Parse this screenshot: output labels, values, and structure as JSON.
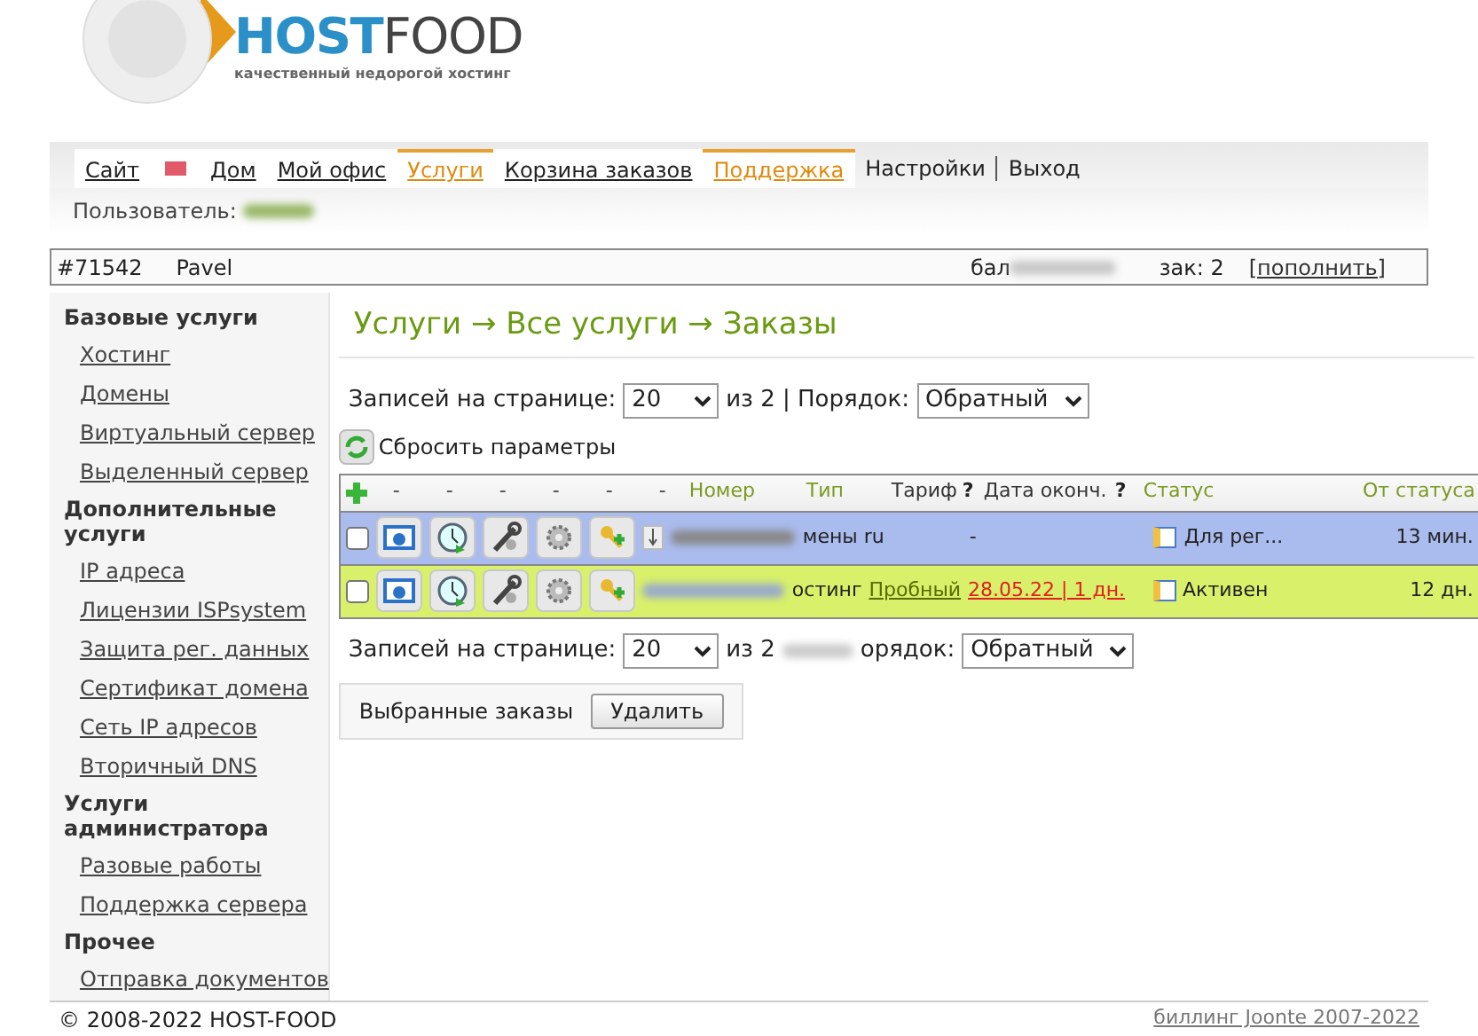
{
  "logo": {
    "brand_part_1": "HOST",
    "brand_part_2": "FOOD",
    "tagline": "качественный недорогой хостинг"
  },
  "nav": [
    {
      "label": "Сайт",
      "kind": "link",
      "selected": false
    },
    {
      "kind": "mail",
      "selected": false
    },
    {
      "label": "Дом",
      "kind": "link",
      "selected": false
    },
    {
      "label": "Мой офис",
      "kind": "link",
      "selected": false
    },
    {
      "label": "Услуги",
      "kind": "link",
      "selected": true
    },
    {
      "label": "Корзина заказов",
      "kind": "link",
      "selected": false
    },
    {
      "label": "Поддержка",
      "kind": "link",
      "selected": true
    },
    {
      "label": "Настройки",
      "kind": "plain",
      "selected": false
    },
    {
      "label": "Выход",
      "kind": "plain",
      "selected": false
    }
  ],
  "user_label": "Пользователь:",
  "account": {
    "id": "#71542",
    "name": "Pavel",
    "balance_label": "бал",
    "orders": "зак: 2",
    "topup": "[пополнить]"
  },
  "sidebar": [
    {
      "title": "Базовые услуги",
      "items": [
        "Хостинг",
        "Домены",
        "Виртуальный сервер",
        "Выделенный сервер"
      ]
    },
    {
      "title": "Дополнительные услуги",
      "items": [
        "IP адреса",
        "Лицензии ISPsystem",
        "Защита рег. данных",
        "Сертификат домена",
        "Сеть IP адресов",
        "Вторичный DNS"
      ]
    },
    {
      "title": "Услуги администратора",
      "items": [
        "Разовые работы",
        "Поддержка сервера"
      ]
    },
    {
      "title": "Прочее",
      "items": [
        "Отправка документов"
      ]
    }
  ],
  "heading": "Услуги → Все услуги → Заказы",
  "pager_top": {
    "label": "Записей на странице:",
    "per_page": "20",
    "of": "из 2 | Порядок:",
    "order": "Обратный"
  },
  "reset": "Сбросить параметры",
  "table": {
    "columns": [
      "-",
      "-",
      "-",
      "-",
      "-",
      "-",
      "Номер",
      "Тип",
      "Тариф",
      "?",
      "Дата оконч.",
      "?",
      "Статус",
      "От статуса"
    ],
    "rows": [
      {
        "checked": false,
        "color": "#aabbee",
        "type": "мены ru",
        "tariff": "",
        "date": "-",
        "status": "Для рег...",
        "since": "13 мин."
      },
      {
        "checked": false,
        "color": "#d9f06a",
        "type": "остинг",
        "tariff": "Пробный",
        "date": "28.05.22 | 1 дн.",
        "status": "Активен",
        "since": "12 дн."
      }
    ]
  },
  "pager_bottom": {
    "label": "Записей на странице:",
    "per_page": "20",
    "of": "из 2",
    "order_cut": "орядок:",
    "order": "Обратный"
  },
  "bulk": {
    "label": "Выбранные заказы",
    "button": "Удалить"
  },
  "footer": {
    "copyright": "© 2008-2022 HOST-FOOD",
    "billing": "биллинг Joonte 2007-2022"
  }
}
